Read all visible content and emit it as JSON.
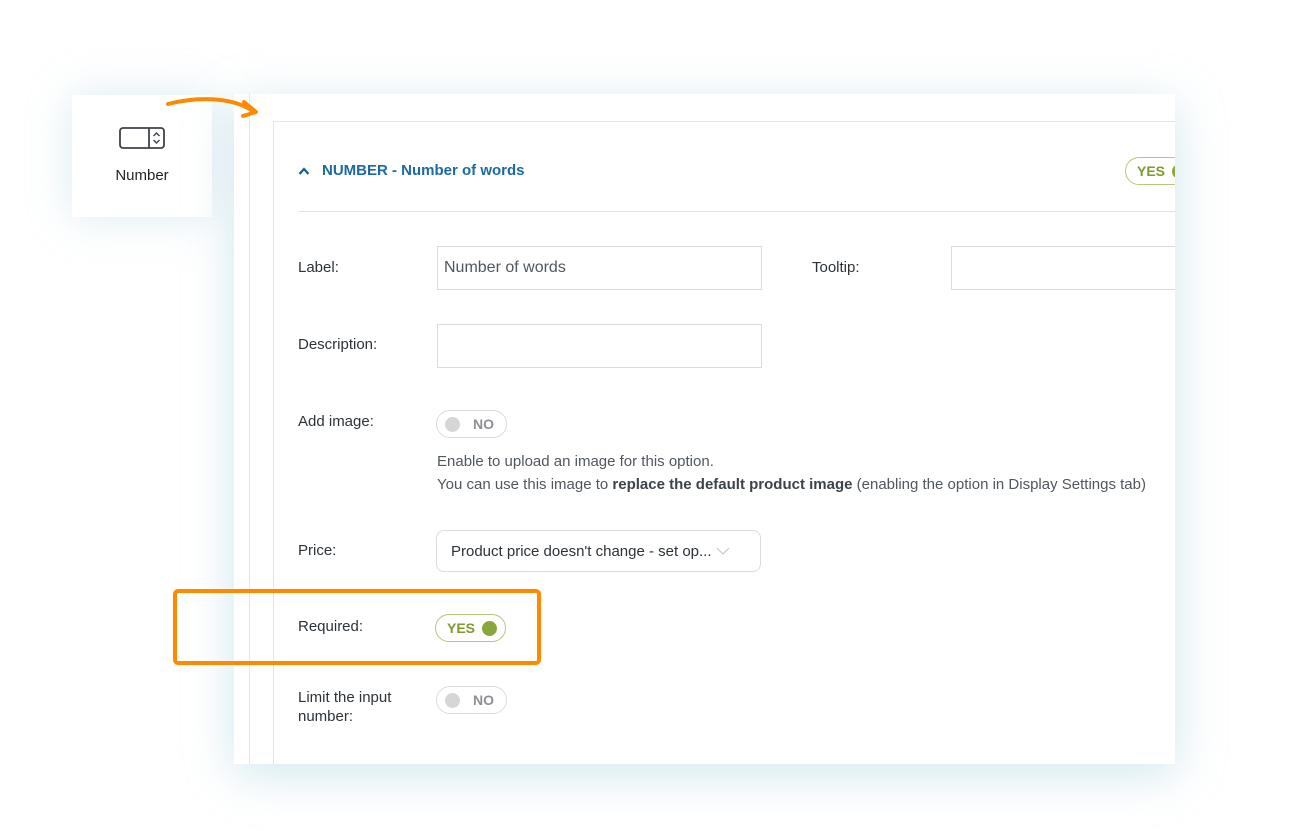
{
  "palette": {
    "icon": "number-input-icon",
    "label": "Number"
  },
  "field": {
    "header": {
      "type": "NUMBER",
      "title": "NUMBER - Number of words",
      "collapse_icon": "chevron-up-icon",
      "enabled_label": "YES",
      "enabled": true
    },
    "label": {
      "label": "Label:",
      "value": "Number of words"
    },
    "tooltip": {
      "label": "Tooltip:",
      "value": ""
    },
    "description": {
      "label": "Description:",
      "value": ""
    },
    "add_image": {
      "label": "Add image:",
      "switch_label": "NO",
      "enabled": false,
      "help_line1": "Enable to upload an image for this option.",
      "help_line2_prefix": "You can use this image to ",
      "help_line2_bold": "replace the default product image",
      "help_line2_suffix": " (enabling the option in Display Settings tab)"
    },
    "price": {
      "label": "Price:",
      "selected": "Product price doesn't change - set op..."
    },
    "required": {
      "label": "Required:",
      "switch_label": "YES",
      "enabled": true
    },
    "limit": {
      "label": "Limit the input number:",
      "switch_label": "NO",
      "enabled": false
    }
  },
  "colors": {
    "accent_orange": "#ff8a00",
    "title_blue": "#1a6aa3",
    "switch_on_green": "#8aa83a",
    "switch_off_gray": "#d6d6d6"
  }
}
